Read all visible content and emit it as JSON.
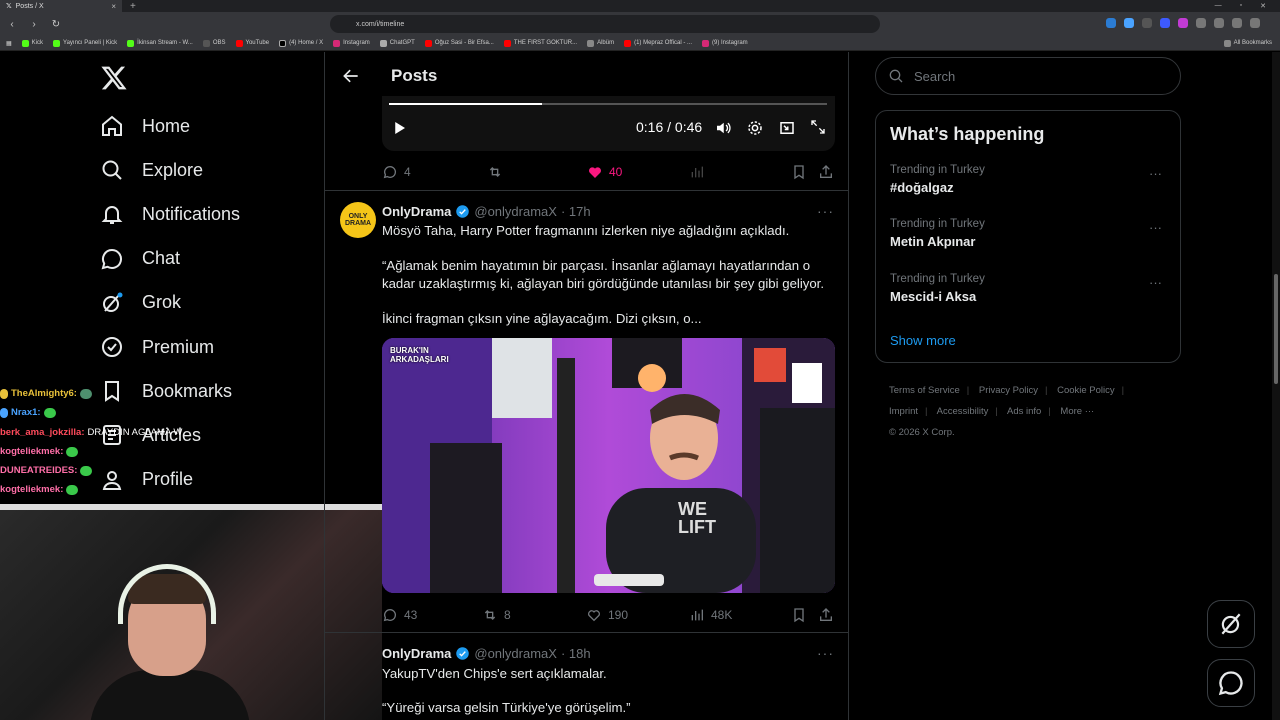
{
  "browser": {
    "tab_title": "Posts / X",
    "url": "x.com/i/timeline",
    "bookmarks": [
      "Kick",
      "Yayıncı Paneli | Kick",
      "İkinsan Stream - W...",
      "OBS",
      "YouTube",
      "(4) Home / X",
      "Instagram",
      "ChatGPT",
      "Oğuz Sasi - Bir Efsa...",
      "THE FIRST GOKTUR...",
      "Albüm",
      "(1) Mepraz Offical - ...",
      "(9) Instagram"
    ],
    "all_bookmarks": "All Bookmarks"
  },
  "nav": {
    "home": "Home",
    "explore": "Explore",
    "notifications": "Notifications",
    "chat": "Chat",
    "grok": "Grok",
    "premium": "Premium",
    "bookmarks": "Bookmarks",
    "articles": "Articles",
    "profile": "Profile"
  },
  "header": {
    "title": "Posts"
  },
  "video": {
    "time": "0:16 / 0:46",
    "progress": 0.35
  },
  "prev_actions": {
    "replies": "4",
    "reposts": "",
    "likes": "40"
  },
  "post1": {
    "name": "OnlyDrama",
    "handle": "@onlydramaX",
    "time": "· 17h",
    "avatar_text": "ONLY DRAMA",
    "line1": "Mösyö Taha, Harry Potter fragmanını izlerken niye ağladığını açıkladı.",
    "line2": "“Ağlamak benim hayatımın bir parçası. İnsanlar ağlamayı hayatlarından o kadar uzaklaştırmış ki, ağlayan biri gördüğünde utanılası bir şey gibi geliyor.",
    "line3": "İkinci fragman çıksın yine ağlayacağım. Dizi çıksın, o...",
    "media_badge": "BURAK'IN ARKADAŞLARI",
    "shirt": "WE LIFT",
    "replies": "43",
    "reposts": "8",
    "likes": "190",
    "views": "48K"
  },
  "post2": {
    "name": "OnlyDrama",
    "handle": "@onlydramaX",
    "time": "· 18h",
    "line1": "YakupTV'den Chips'e sert açıklamalar.",
    "line2": "“Yüreği varsa gelsin Türkiye'ye görüşelim.”"
  },
  "search": {
    "placeholder": "Search"
  },
  "trends": {
    "title": "What’s happening",
    "items": [
      {
        "meta": "Trending in Turkey",
        "name": "#doğalgaz"
      },
      {
        "meta": "Trending in Turkey",
        "name": "Metin Akpınar"
      },
      {
        "meta": "Trending in Turkey",
        "name": "Mescid-i Aksa"
      }
    ],
    "show_more": "Show more"
  },
  "footer": {
    "tos": "Terms of Service",
    "privacy": "Privacy Policy",
    "cookie": "Cookie Policy",
    "imprint": "Imprint",
    "accessibility": "Accessibility",
    "ads": "Ads info",
    "more": "More ···",
    "copyright": "© 2026 X Corp."
  },
  "stream_chat": [
    {
      "user": "TheAlmighty6:",
      "msg": "",
      "color": "#e8c13a"
    },
    {
      "user": "Nrax1:",
      "msg": "",
      "color": "#4aa3ff"
    },
    {
      "user": "berk_ama_jokzilla:",
      "msg": "DRAYDIN AGLAMA W",
      "color": "#ff4b5c"
    },
    {
      "user": "kogteliekmek:",
      "msg": "",
      "color": "#ff6fa8"
    },
    {
      "user": "DUNEATREIDES:",
      "msg": "",
      "color": "#ff6fa8"
    },
    {
      "user": "kogteliekmek:",
      "msg": "",
      "color": "#ff6fa8"
    }
  ],
  "colors": {
    "accent": "#1d9bf0",
    "like": "#f91880",
    "muted": "#71767b"
  }
}
